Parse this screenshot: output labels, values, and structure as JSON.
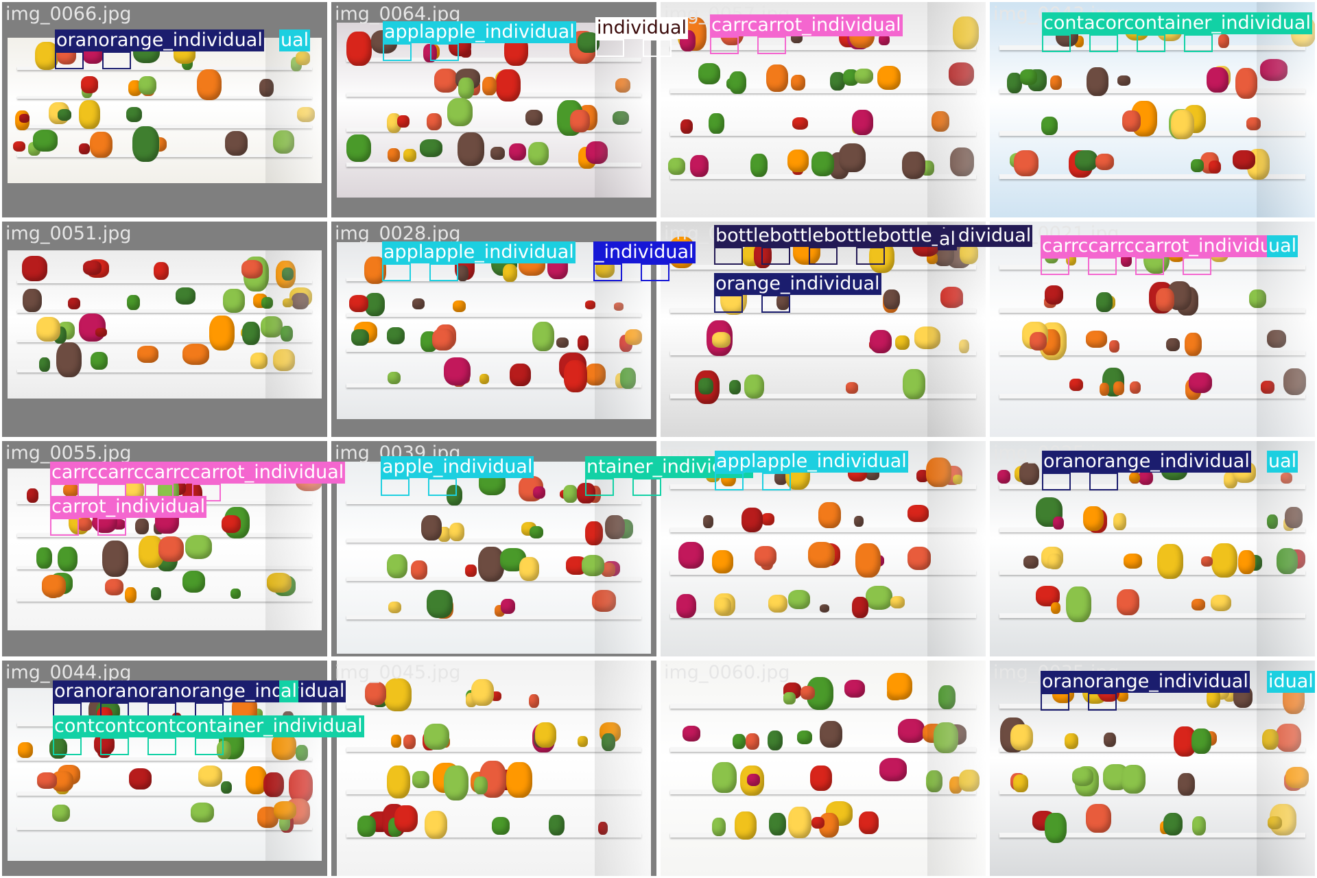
{
  "colors": {
    "orange_individual": "#1b1d6e",
    "apple_individual": "#1ccfe0",
    "carrot_individual": "#f466cf",
    "container_individual": "#12d1a5",
    "bottle_individual": "#231a55",
    "mislabel_brown": "#ffffff",
    "blue_individual": "#1617d6",
    "grid_background": "#7f7f7f",
    "filename_text": "#e6e6e6"
  },
  "tiles": [
    {
      "name": "img_0066.jpg",
      "wall": "#f2f0ea",
      "labels": [
        {
          "text": "oranorange_individual",
          "cls": "orange_individual"
        },
        {
          "text": "ual",
          "cls": "apple_individual"
        }
      ]
    },
    {
      "name": "img_0064.jpg",
      "wall": "#dcd6da",
      "labels": [
        {
          "text": "applapple_individual",
          "cls": "apple_individual"
        },
        {
          "text": "individual",
          "cls": "mislabel_brown"
        }
      ]
    },
    {
      "name": "img_0057.jpg",
      "wall": "#e8e8e8",
      "labels": [
        {
          "text": "carrcarrot_individual",
          "cls": "carrot_individual"
        }
      ]
    },
    {
      "name": "img_0043.jpg",
      "wall": "#cfe3f2",
      "labels": [
        {
          "text": "contacorcontainer_individual",
          "cls": "container_individual"
        }
      ]
    },
    {
      "name": "img_0051.jpg",
      "wall": "#ececec",
      "labels": []
    },
    {
      "name": "img_0028.jpg",
      "wall": "#e6e8ea",
      "labels": [
        {
          "text": "applapple_individual",
          "cls": "apple_individual"
        },
        {
          "text": "_individual",
          "cls": "blue_individual"
        }
      ]
    },
    {
      "name": "img_0036.jpg",
      "wall": "#d9d9d9",
      "labels": [
        {
          "text": "bottlebottlebottlebottle_individual",
          "cls": "bottle_individual"
        },
        {
          "text": "al",
          "cls": "bottle_individual"
        },
        {
          "text": "orange_individual",
          "cls": "orange_individual"
        }
      ]
    },
    {
      "name": "img_0021.jpg",
      "wall": "#e9ecef",
      "labels": [
        {
          "text": "carrccarrccarrot_individual",
          "cls": "carrot_individual"
        },
        {
          "text": "ual",
          "cls": "apple_individual"
        }
      ]
    },
    {
      "name": "img_0055.jpg",
      "wall": "#f4f4f4",
      "labels": [
        {
          "text": "carrccarrccarrccarrot_individual",
          "cls": "carrot_individual"
        },
        {
          "text": "carrot_individual",
          "cls": "carrot_individual"
        }
      ]
    },
    {
      "name": "img_0039.jpg",
      "wall": "#eceff1",
      "labels": [
        {
          "text": "apple_individual",
          "cls": "apple_individual"
        },
        {
          "text": "ntainer_individual",
          "cls": "container_individual"
        }
      ]
    },
    {
      "name": "img_0034.jpg",
      "wall": "#e3e5e6",
      "labels": [
        {
          "text": "applapple_individual",
          "cls": "apple_individual"
        }
      ]
    },
    {
      "name": "img_0025.jpg",
      "wall": "#dfe2e4",
      "labels": [
        {
          "text": "oranorange_individual",
          "cls": "orange_individual"
        },
        {
          "text": "ual",
          "cls": "apple_individual"
        }
      ]
    },
    {
      "name": "img_0044.jpg",
      "wall": "#eef0f1",
      "labels": [
        {
          "text": "oranoranoranorange_individual",
          "cls": "orange_individual"
        },
        {
          "text": "al",
          "cls": "container_individual"
        },
        {
          "text": "contcontcontcontainer_individual",
          "cls": "container_individual"
        }
      ]
    },
    {
      "name": "img_0045.jpg",
      "wall": "#f2f2f2",
      "labels": []
    },
    {
      "name": "img_0060.jpg",
      "wall": "#f5f5f3",
      "labels": []
    },
    {
      "name": "img_0035.jpg",
      "wall": "#d8dadc",
      "labels": [
        {
          "text": "oranorange_individual",
          "cls": "orange_individual"
        },
        {
          "text": "idual",
          "cls": "apple_individual"
        }
      ]
    }
  ]
}
